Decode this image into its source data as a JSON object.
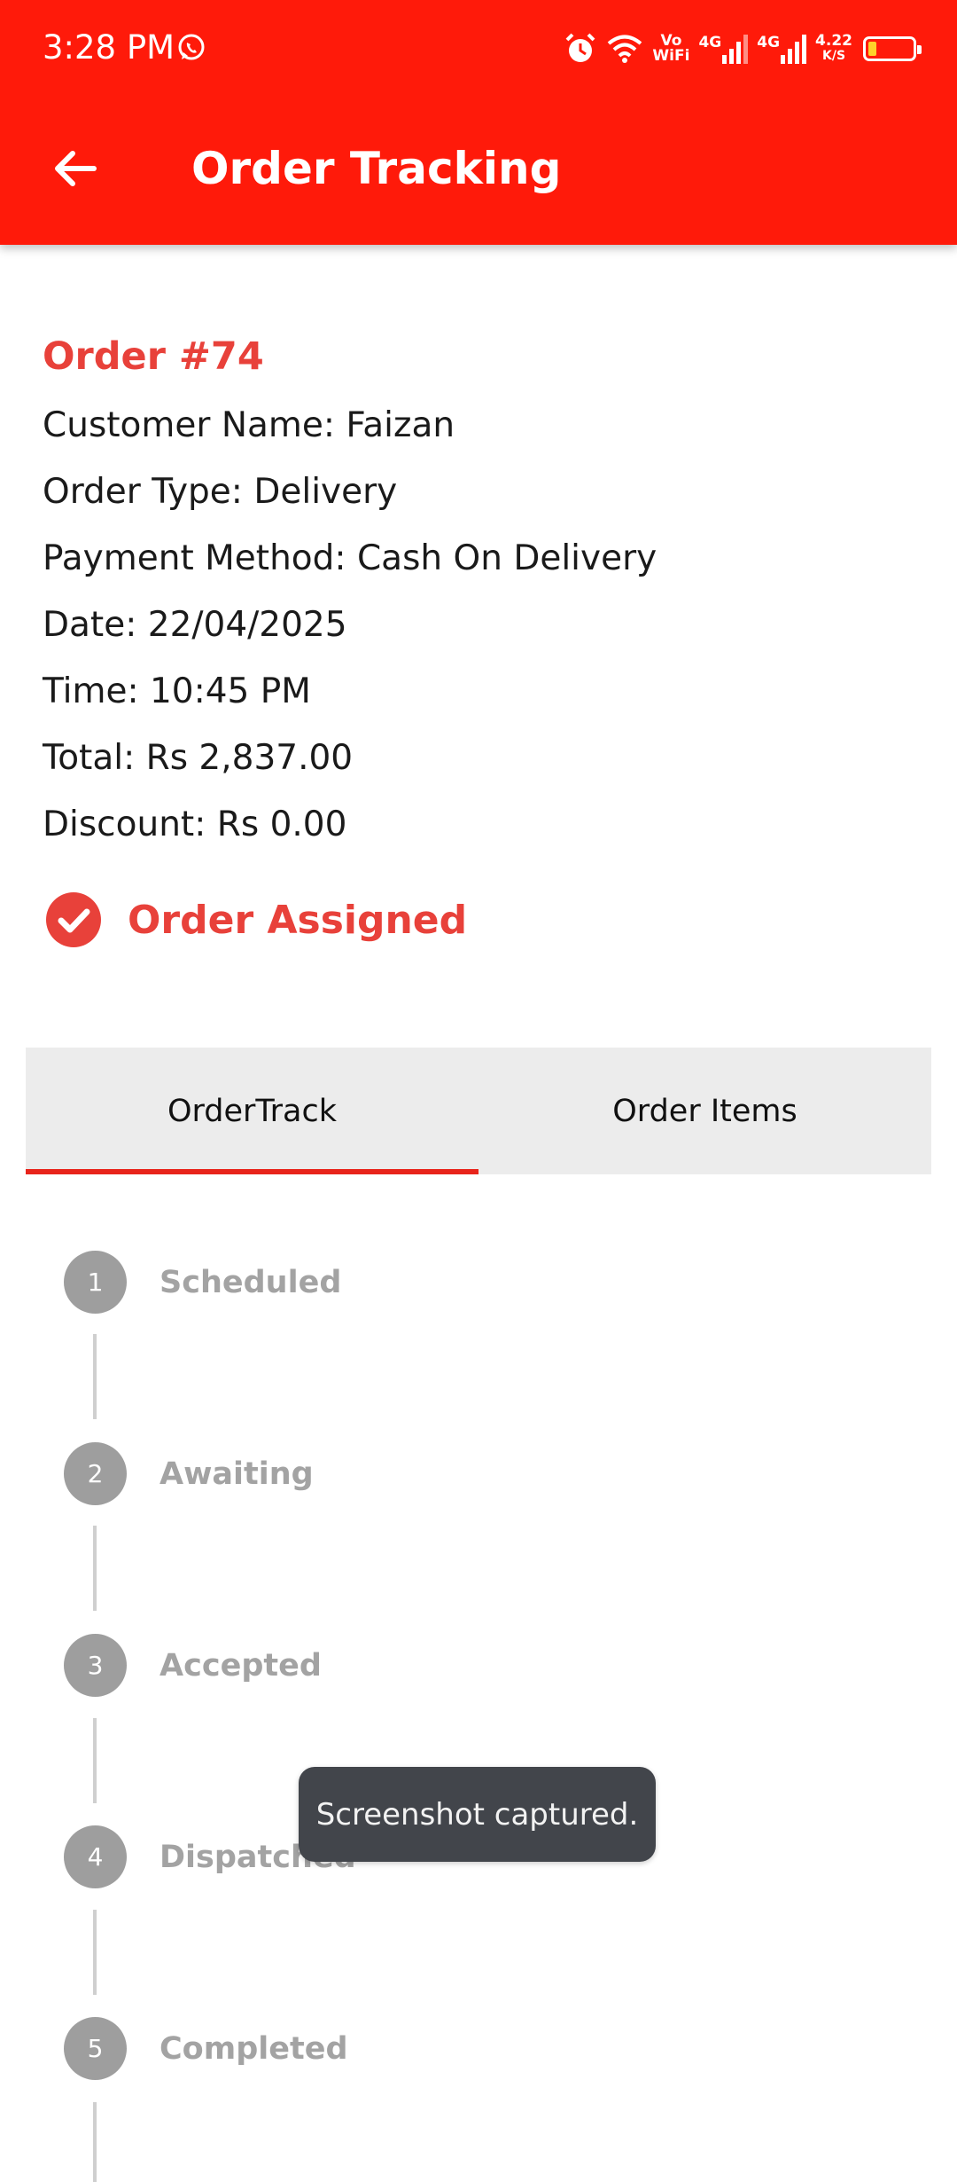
{
  "status_bar": {
    "time": "3:28 PM",
    "vowifi_top": "Vo",
    "vowifi_bottom": "WiFi",
    "net1": "4G",
    "net2": "4G",
    "speed_value": "4.22",
    "speed_unit": "K/S",
    "icons": [
      "whatsapp-icon",
      "alarm-icon",
      "wifi-icon",
      "signal-icon",
      "battery-icon"
    ]
  },
  "header": {
    "title": "Order Tracking",
    "back_icon": "arrow-left-icon",
    "color": "#ff1a0a"
  },
  "order": {
    "number": "Order #74",
    "customer": "Customer Name: Faizan",
    "type": "Order Type: Delivery",
    "payment": "Payment Method: Cash On Delivery",
    "date": "Date: 22/04/2025",
    "time": "Time: 10:45 PM",
    "total": "Total: Rs 2,837.00",
    "discount": "Discount: Rs 0.00",
    "status": "Order Assigned",
    "accent_color": "#e8413a"
  },
  "tabs": {
    "items": [
      {
        "label": "OrderTrack",
        "active": true
      },
      {
        "label": "Order Items",
        "active": false
      }
    ]
  },
  "timeline": {
    "steps": [
      {
        "number": "1",
        "label": "Scheduled"
      },
      {
        "number": "2",
        "label": "Awaiting"
      },
      {
        "number": "3",
        "label": "Accepted"
      },
      {
        "number": "4",
        "label": "Dispatched"
      },
      {
        "number": "5",
        "label": "Completed"
      }
    ]
  },
  "toast": {
    "message": "Screenshot captured."
  }
}
